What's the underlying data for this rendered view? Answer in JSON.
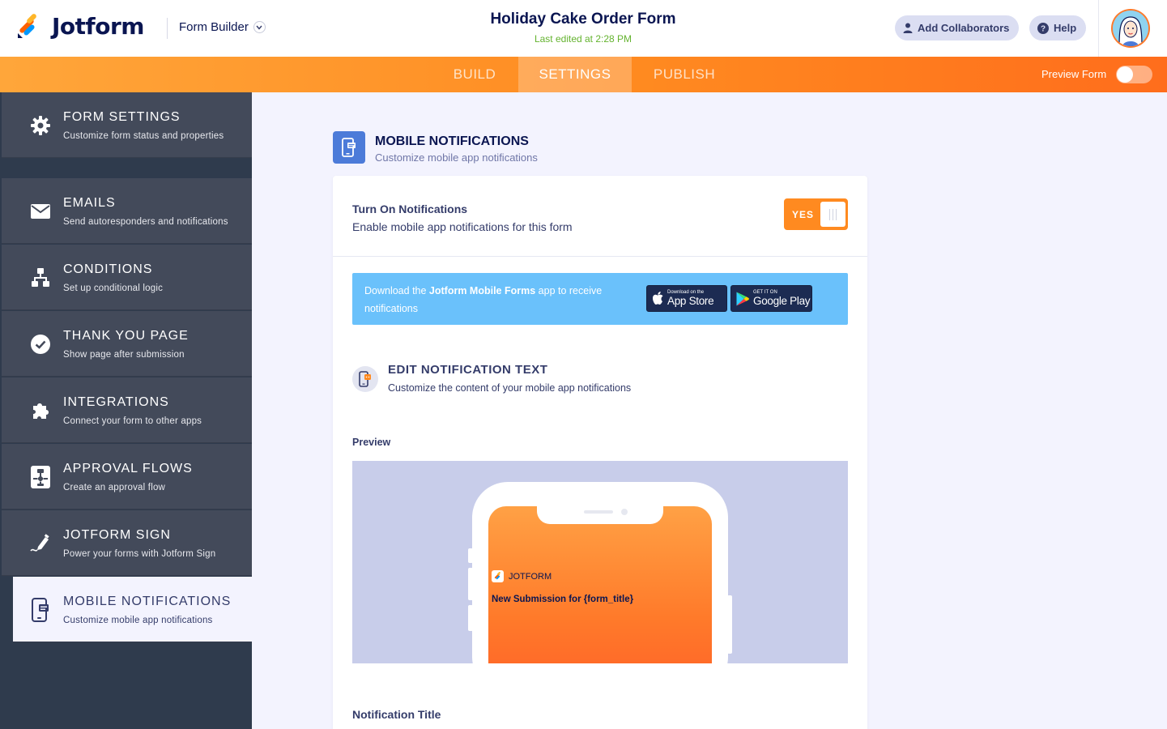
{
  "header": {
    "brand": "Jotform",
    "builder_label": "Form Builder",
    "form_title": "Holiday Cake Order Form",
    "last_edited": "Last edited at 2:28 PM",
    "add_collaborators": "Add Collaborators",
    "help": "Help"
  },
  "tabs": {
    "build": "BUILD",
    "settings": "SETTINGS",
    "publish": "PUBLISH",
    "active": "SETTINGS",
    "preview_form": "Preview Form",
    "preview_form_on": false
  },
  "sidebar": {
    "items": [
      {
        "title": "FORM SETTINGS",
        "subtitle": "Customize form status and properties",
        "icon": "gear-icon"
      },
      {
        "title": "EMAILS",
        "subtitle": "Send autoresponders and notifications",
        "icon": "envelope-icon"
      },
      {
        "title": "CONDITIONS",
        "subtitle": "Set up conditional logic",
        "icon": "conditions-icon"
      },
      {
        "title": "THANK YOU PAGE",
        "subtitle": "Show page after submission",
        "icon": "check-circle-icon"
      },
      {
        "title": "INTEGRATIONS",
        "subtitle": "Connect your form to other apps",
        "icon": "puzzle-icon"
      },
      {
        "title": "APPROVAL FLOWS",
        "subtitle": "Create an approval flow",
        "icon": "approval-flow-icon"
      },
      {
        "title": "JOTFORM SIGN",
        "subtitle": "Power your forms with Jotform Sign",
        "icon": "pen-icon"
      },
      {
        "title": "MOBILE NOTIFICATIONS",
        "subtitle": "Customize mobile app notifications",
        "icon": "mobile-icon"
      }
    ],
    "active_index": 7
  },
  "main": {
    "section_title": "MOBILE NOTIFICATIONS",
    "section_subtitle": "Customize mobile app notifications",
    "turn_on_title": "Turn On Notifications",
    "turn_on_subtitle": "Enable mobile app notifications for this form",
    "toggle_label": "YES",
    "toggle_on": true,
    "download_pre": "Download the ",
    "download_strong": "Jotform Mobile Forms",
    "download_post": " app to receive notifications",
    "app_store_small": "Download on the",
    "app_store_big": "App Store",
    "google_play_small": "GET IT ON",
    "google_play_big": "Google Play",
    "edit_title": "EDIT NOTIFICATION TEXT",
    "edit_subtitle": "Customize the content of your mobile app notifications",
    "preview_label": "Preview",
    "notif_app_name": "JOTFORM",
    "notif_title": "New Submission for {form_title}",
    "notification_title_label": "Notification Title"
  },
  "colors": {
    "accent_orange": "#ff8a20",
    "sidebar_bg": "#434a5a",
    "navy": "#0a1551",
    "download_blue": "#6ac1fb",
    "edited_green": "#64b32f"
  }
}
